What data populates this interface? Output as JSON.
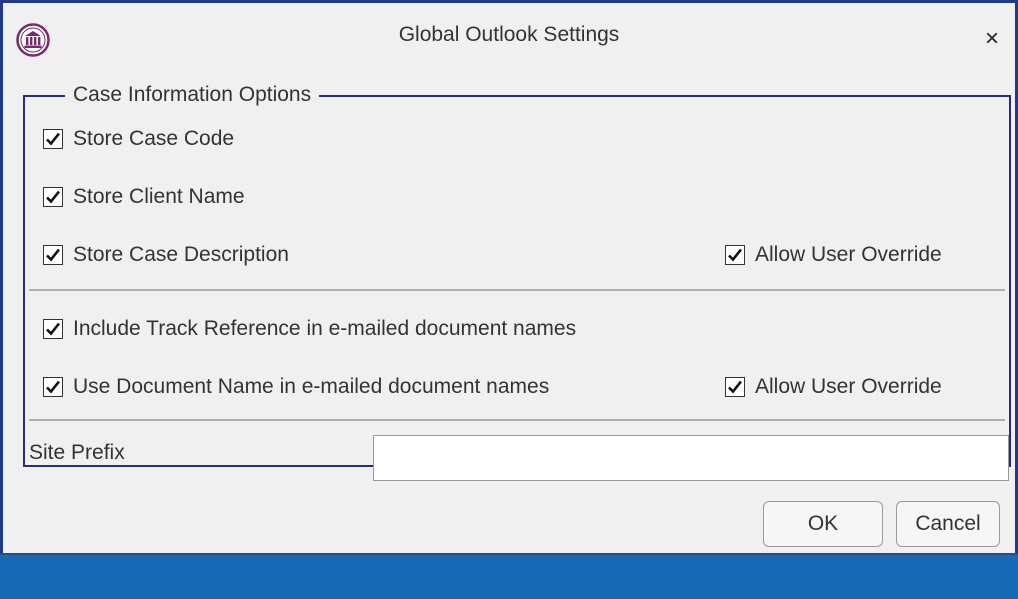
{
  "window": {
    "title": "Global Outlook Settings",
    "close_label": "×"
  },
  "group": {
    "legend": "Case Information Options",
    "items": [
      {
        "label": "Store Case Code",
        "checked": true
      },
      {
        "label": "Store Client Name",
        "checked": true
      },
      {
        "label": "Store Case Description",
        "checked": true
      },
      {
        "label": "Include Track Reference in e-mailed document names",
        "checked": true
      },
      {
        "label": "Use Document Name in e-mailed document names",
        "checked": true
      }
    ],
    "override_1": {
      "label": "Allow User Override",
      "checked": true
    },
    "override_2": {
      "label": "Allow User Override",
      "checked": true
    },
    "site_prefix": {
      "label": "Site Prefix",
      "value": ""
    }
  },
  "buttons": {
    "ok": "OK",
    "cancel": "Cancel"
  },
  "colors": {
    "frame": "#1f3a8a",
    "footer": "#1769b3",
    "group_border": "#2a2a8a"
  }
}
